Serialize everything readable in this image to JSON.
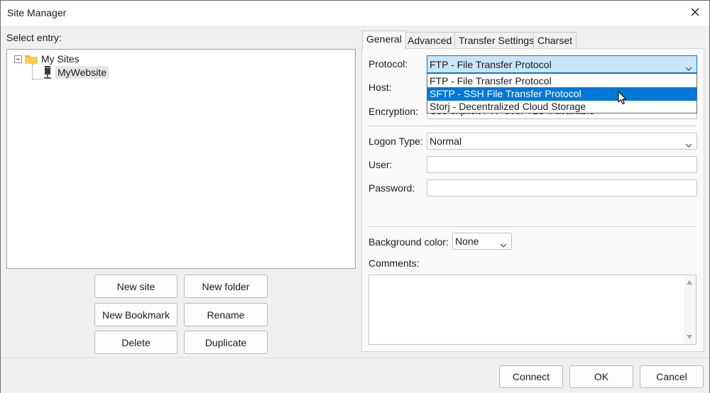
{
  "window": {
    "title": "Site Manager"
  },
  "left": {
    "select_entry_label": "Select entry:",
    "tree": {
      "root_label": "My Sites",
      "items": [
        {
          "label": "MyWebsite"
        }
      ]
    },
    "buttons": {
      "new_site": "New site",
      "new_folder": "New folder",
      "new_bookmark": "New Bookmark",
      "rename": "Rename",
      "delete": "Delete",
      "duplicate": "Duplicate"
    }
  },
  "tabs": [
    "General",
    "Advanced",
    "Transfer Settings",
    "Charset"
  ],
  "general": {
    "protocol_label": "Protocol:",
    "protocol_value": "FTP - File Transfer Protocol",
    "protocol_options": [
      "FTP - File Transfer Protocol",
      "SFTP - SSH File Transfer Protocol",
      "Storj - Decentralized Cloud Storage"
    ],
    "highlighted_option": "SFTP - SSH File Transfer Protocol",
    "host_label": "Host:",
    "encryption_label": "Encryption:",
    "encryption_value": "Use explicit FTP over TLS if available",
    "logon_type_label": "Logon Type:",
    "logon_type_value": "Normal",
    "user_label": "User:",
    "user_value": "",
    "password_label": "Password:",
    "password_value": "",
    "background_color_label": "Background color:",
    "background_color_value": "None",
    "comments_label": "Comments:",
    "comments_value": ""
  },
  "footer": {
    "connect": "Connect",
    "ok": "OK",
    "cancel": "Cancel"
  },
  "colors": {
    "accent": "#0078d7",
    "selection_bg": "#cce4f7",
    "folder": "#f4b942"
  },
  "icons": {
    "close": "close-icon",
    "folder": "folder-icon",
    "server": "server-icon",
    "chevron": "chevron-down-icon",
    "cursor": "mouse-cursor-icon"
  }
}
